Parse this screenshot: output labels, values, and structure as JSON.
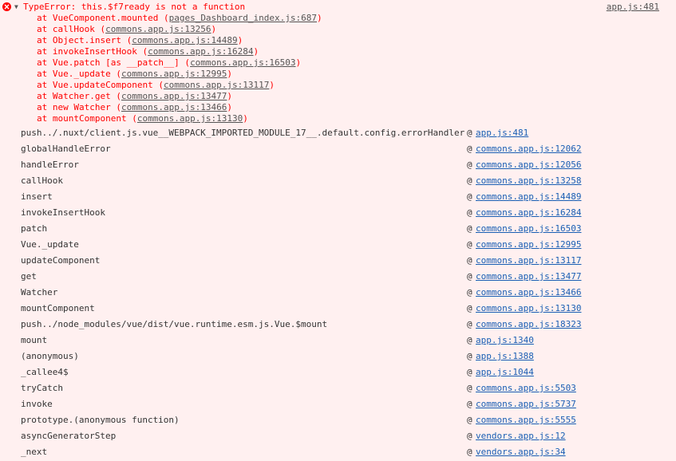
{
  "error": {
    "message": "TypeError: this.$f7ready is not a function",
    "source": "app.js:481",
    "colors": {
      "error_text": "#ff0000",
      "background": "#fff0f0",
      "link": "#1a5fb4"
    }
  },
  "stack": [
    {
      "prefix": "at VueComponent.mounted (",
      "loc": "pages_Dashboard_index.js:687",
      "suffix": ")"
    },
    {
      "prefix": "at callHook (",
      "loc": "commons.app.js:13256",
      "suffix": ")"
    },
    {
      "prefix": "at Object.insert (",
      "loc": "commons.app.js:14489",
      "suffix": ")"
    },
    {
      "prefix": "at invokeInsertHook (",
      "loc": "commons.app.js:16284",
      "suffix": ")"
    },
    {
      "prefix": "at Vue.patch [as __patch__] (",
      "loc": "commons.app.js:16503",
      "suffix": ")"
    },
    {
      "prefix": "at Vue._update (",
      "loc": "commons.app.js:12995",
      "suffix": ")"
    },
    {
      "prefix": "at Vue.updateComponent (",
      "loc": "commons.app.js:13117",
      "suffix": ")"
    },
    {
      "prefix": "at Watcher.get (",
      "loc": "commons.app.js:13477",
      "suffix": ")"
    },
    {
      "prefix": "at new Watcher (",
      "loc": "commons.app.js:13466",
      "suffix": ")"
    },
    {
      "prefix": "at mountComponent (",
      "loc": "commons.app.js:13130",
      "suffix": ")"
    }
  ],
  "trace": [
    {
      "fn": "push../.nuxt/client.js.vue__WEBPACK_IMPORTED_MODULE_17__.default.config.errorHandler",
      "at": "@",
      "link": "app.js:481"
    },
    {
      "fn": "globalHandleError",
      "at": "@",
      "link": "commons.app.js:12062"
    },
    {
      "fn": "handleError",
      "at": "@",
      "link": "commons.app.js:12056"
    },
    {
      "fn": "callHook",
      "at": "@",
      "link": "commons.app.js:13258"
    },
    {
      "fn": "insert",
      "at": "@",
      "link": "commons.app.js:14489"
    },
    {
      "fn": "invokeInsertHook",
      "at": "@",
      "link": "commons.app.js:16284"
    },
    {
      "fn": "patch",
      "at": "@",
      "link": "commons.app.js:16503"
    },
    {
      "fn": "Vue._update",
      "at": "@",
      "link": "commons.app.js:12995"
    },
    {
      "fn": "updateComponent",
      "at": "@",
      "link": "commons.app.js:13117"
    },
    {
      "fn": "get",
      "at": "@",
      "link": "commons.app.js:13477"
    },
    {
      "fn": "Watcher",
      "at": "@",
      "link": "commons.app.js:13466"
    },
    {
      "fn": "mountComponent",
      "at": "@",
      "link": "commons.app.js:13130"
    },
    {
      "fn": "push../node_modules/vue/dist/vue.runtime.esm.js.Vue.$mount",
      "at": "@",
      "link": "commons.app.js:18323"
    },
    {
      "fn": "mount",
      "at": "@",
      "link": "app.js:1340"
    },
    {
      "fn": "(anonymous)",
      "at": "@",
      "link": "app.js:1388"
    },
    {
      "fn": "_callee4$",
      "at": "@",
      "link": "app.js:1044"
    },
    {
      "fn": "tryCatch",
      "at": "@",
      "link": "commons.app.js:5503"
    },
    {
      "fn": "invoke",
      "at": "@",
      "link": "commons.app.js:5737"
    },
    {
      "fn": "prototype.(anonymous function)",
      "at": "@",
      "link": "commons.app.js:5555"
    },
    {
      "fn": "asyncGeneratorStep",
      "at": "@",
      "link": "vendors.app.js:12"
    },
    {
      "fn": "_next",
      "at": "@",
      "link": "vendors.app.js:34"
    }
  ]
}
